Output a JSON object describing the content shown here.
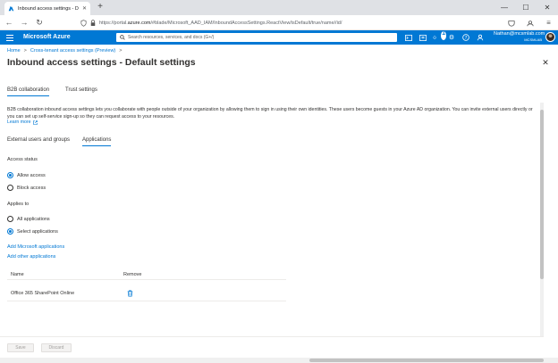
{
  "browser": {
    "tab_title": "Inbound access settings - Defa",
    "url_prefix": "https://portal.",
    "url_domain": "azure.com",
    "url_path": "/#blade/Microsoft_AAD_IAM/InboundAccessSettings.ReactView/isDefault/true/name//id/"
  },
  "azure_bar": {
    "brand": "Microsoft Azure",
    "search_placeholder": "Search resources, services, and docs (G+/)",
    "notification_count": "1",
    "user_name": "Nathan@mcsmlab.com",
    "user_tenant": "MCSMLAB"
  },
  "breadcrumb": {
    "home": "Home",
    "separator": ">",
    "parent": "Cross-tenant access settings (Preview)",
    "trailing": ">"
  },
  "page": {
    "title": "Inbound access settings - Default settings",
    "more": "···"
  },
  "top_tabs": [
    {
      "label": "B2B collaboration",
      "active": true
    },
    {
      "label": "Trust settings",
      "active": false
    }
  ],
  "description": "B2B collaboration inbound access settings lets you collaborate with people outside of your organization by allowing them to sign in using their own identities. These users become guests in your Azure AD organization. You can invite external users directly or you can set up self-service sign-up so they can request access to your resources.",
  "learn_more": "Learn more",
  "sub_tabs": [
    {
      "label": "External users and groups",
      "active": false
    },
    {
      "label": "Applications",
      "active": true
    }
  ],
  "access_status": {
    "label": "Access status",
    "options": [
      {
        "label": "Allow access",
        "checked": true
      },
      {
        "label": "Block access",
        "checked": false
      }
    ]
  },
  "applies_to": {
    "label": "Applies to",
    "options": [
      {
        "label": "All applications",
        "checked": false
      },
      {
        "label": "Select applications",
        "checked": true
      }
    ]
  },
  "links": {
    "add_microsoft_apps": "Add Microsoft applications",
    "add_other_apps": "Add other applications"
  },
  "table": {
    "columns": [
      "Name",
      "Remove"
    ],
    "rows": [
      {
        "name": "Office 365 SharePoint Online"
      }
    ]
  },
  "footer": {
    "save": "Save",
    "discard": "Discard"
  },
  "colors": {
    "azure_blue": "#0078d4",
    "text": "#323130",
    "disabled_text": "#a19f9d"
  }
}
